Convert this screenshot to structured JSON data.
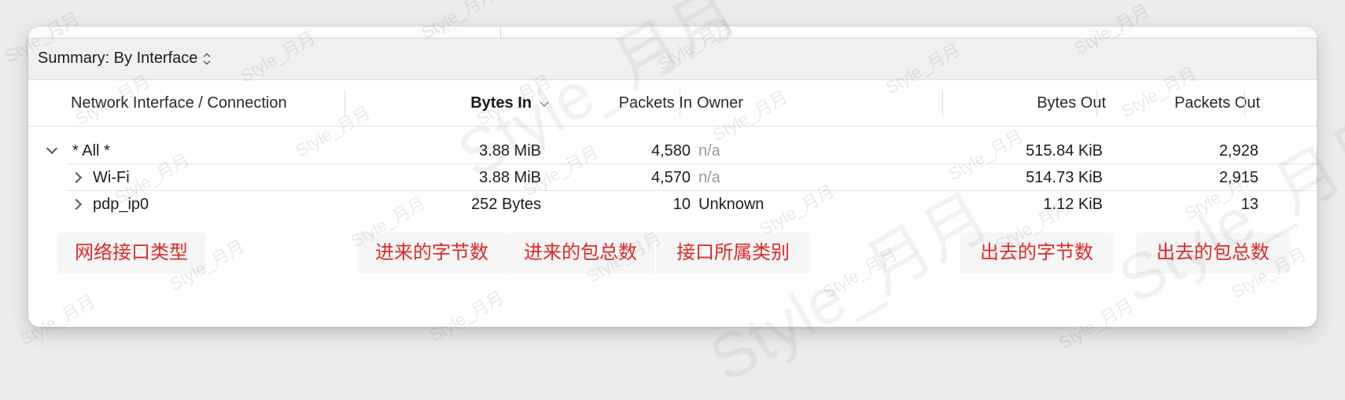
{
  "summary": {
    "label": "Summary: By Interface"
  },
  "columns": {
    "interface": "Network Interface / Connection",
    "bytes_in": "Bytes In",
    "packets_in": "Packets In",
    "owner": "Owner",
    "bytes_out": "Bytes Out",
    "packets_out": "Packets Out"
  },
  "rows": [
    {
      "name": "* All *",
      "bytes_in": "3.88 MiB",
      "packets_in": "4,580",
      "owner": "n/a",
      "bytes_out": "515.84 KiB",
      "packets_out": "2,928"
    },
    {
      "name": "Wi-Fi",
      "bytes_in": "3.88 MiB",
      "packets_in": "4,570",
      "owner": "n/a",
      "bytes_out": "514.73 KiB",
      "packets_out": "2,915"
    },
    {
      "name": "pdp_ip0",
      "bytes_in": "252 Bytes",
      "packets_in": "10",
      "owner": "Unknown",
      "bytes_out": "1.12 KiB",
      "packets_out": "13"
    }
  ],
  "annotations": {
    "interface_type": "网络接口类型",
    "bytes_in": "进来的字节数",
    "packets_in": "进来的包总数",
    "owner": "接口所属类别",
    "bytes_out": "出去的字节数",
    "packets_out": "出去的包总数"
  },
  "watermark": "Style_月月",
  "colors": {
    "annotation": "#e02828",
    "muted": "#9a9a9a"
  }
}
